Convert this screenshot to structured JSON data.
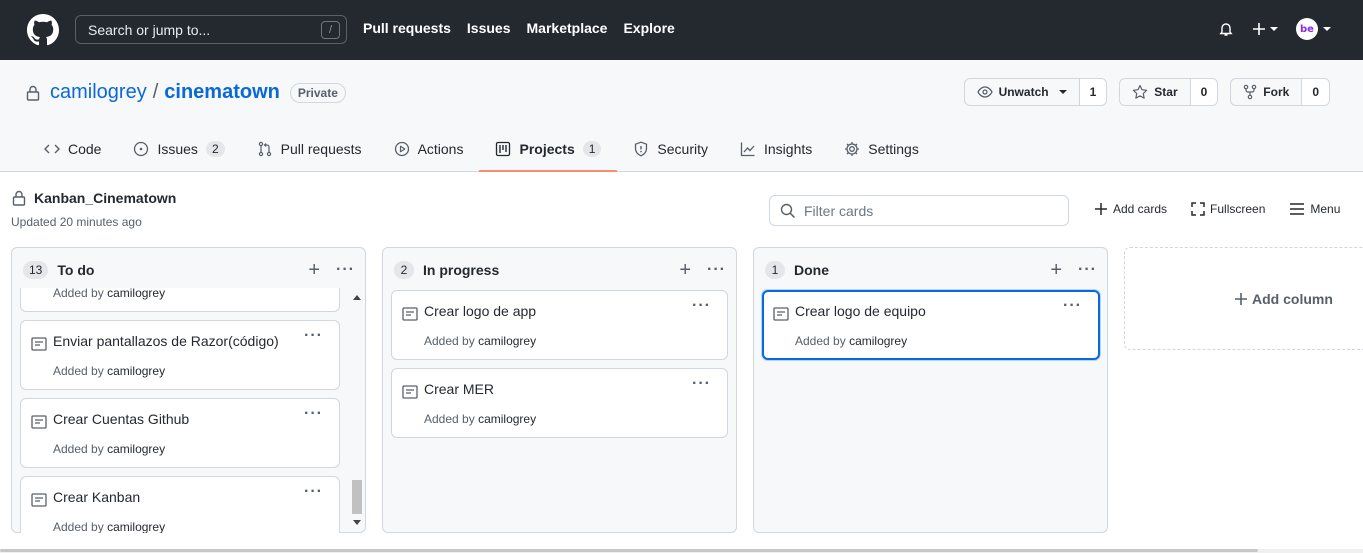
{
  "header": {
    "search_placeholder": "Search or jump to...",
    "search_shortcut": "/",
    "nav": [
      "Pull requests",
      "Issues",
      "Marketplace",
      "Explore"
    ],
    "avatar_text": "be"
  },
  "repo": {
    "owner": "camilogrey",
    "separator": "/",
    "name": "cinematown",
    "visibility": "Private",
    "watch": {
      "label": "Unwatch",
      "count": "1"
    },
    "star": {
      "label": "Star",
      "count": "0"
    },
    "fork": {
      "label": "Fork",
      "count": "0"
    },
    "tabs": [
      {
        "label": "Code",
        "icon": "code-icon"
      },
      {
        "label": "Issues",
        "count": "2",
        "icon": "issue-icon"
      },
      {
        "label": "Pull requests",
        "icon": "pull-request-icon"
      },
      {
        "label": "Actions",
        "icon": "play-icon"
      },
      {
        "label": "Projects",
        "count": "1",
        "icon": "project-icon",
        "active": true
      },
      {
        "label": "Security",
        "icon": "shield-icon"
      },
      {
        "label": "Insights",
        "icon": "graph-icon"
      },
      {
        "label": "Settings",
        "icon": "gear-icon"
      }
    ]
  },
  "project": {
    "name": "Kanban_Cinematown",
    "updated": "Updated 20 minutes ago",
    "filter_placeholder": "Filter cards",
    "add_cards": "Add cards",
    "fullscreen": "Fullscreen",
    "menu": "Menu",
    "add_column": "Add column"
  },
  "columns": [
    {
      "count": "13",
      "title": "To do",
      "cards": [
        {
          "title": "",
          "added_by": "Added by",
          "user": "camilogrey"
        },
        {
          "title": "Enviar pantallazos de Razor(código)",
          "added_by": "Added by",
          "user": "camilogrey"
        },
        {
          "title": "Crear Cuentas Github",
          "added_by": "Added by",
          "user": "camilogrey"
        },
        {
          "title": "Crear Kanban",
          "added_by": "Added by",
          "user": "camilogrey"
        }
      ]
    },
    {
      "count": "2",
      "title": "In progress",
      "cards": [
        {
          "title": "Crear logo de app",
          "added_by": "Added by",
          "user": "camilogrey"
        },
        {
          "title": "Crear MER",
          "added_by": "Added by",
          "user": "camilogrey"
        }
      ]
    },
    {
      "count": "1",
      "title": "Done",
      "cards": [
        {
          "title": "Crear logo de equipo",
          "added_by": "Added by",
          "user": "camilogrey"
        }
      ]
    }
  ],
  "colors": {
    "header_bg": "#24292f",
    "link": "#0969da",
    "active_tab_underline": "#fd8c73",
    "focus_border": "#0969da"
  }
}
